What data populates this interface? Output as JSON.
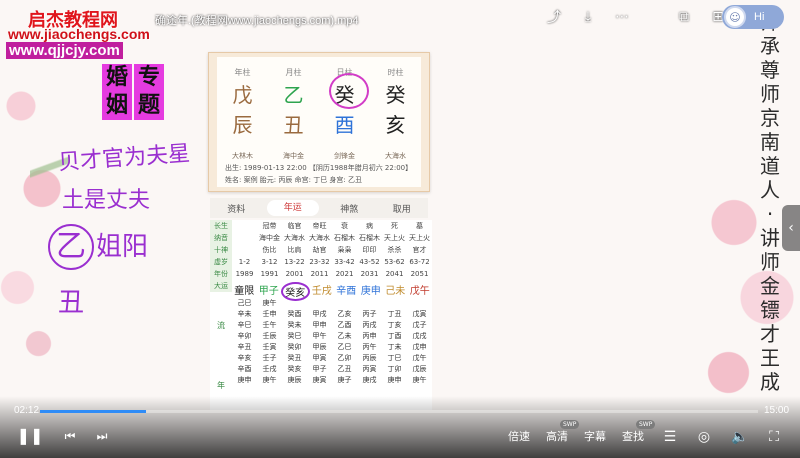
{
  "watermark": {
    "line1": "启杰教程网",
    "line2": "www.jiaochengs.com",
    "line3": "www.qjjcjy.com"
  },
  "video_title": "确途年.(教程网www.jiaochengs.com).mp4",
  "top_controls": {
    "icons": [
      "share-icon",
      "download-icon",
      "more-icon",
      "pip-icon",
      "grid-icon"
    ],
    "assistant_label": "Hi"
  },
  "slide": {
    "topic_tags": [
      "婚",
      "专",
      "姻",
      "题"
    ],
    "handwriting": [
      "贝才官为夫星",
      "土是丈夫",
      "乙",
      "姐阳",
      "丑"
    ],
    "vertical_caption": [
      "师",
      "承",
      "尊",
      "师",
      "京",
      "南",
      "道",
      "人",
      "·",
      "讲",
      "师",
      "金",
      "镖",
      "才",
      "王",
      "成"
    ],
    "bazi_card": {
      "pillar_heads": [
        "年柱",
        "月柱",
        "日柱",
        "时柱"
      ],
      "stems": [
        "戊",
        "乙",
        "癸",
        "癸"
      ],
      "branches": [
        "辰",
        "丑",
        "酉",
        "亥"
      ],
      "nayin": [
        "大林木",
        "海中金",
        "剑锋金",
        "大海水"
      ],
      "birth": "出生: 1989-01-13 22:00  【阴历1988年腊月初六 22:00】",
      "info": "姓名: 案例    胎元: 丙辰  命宫: 丁巳  身宫: 乙丑"
    },
    "tabs": [
      "资料",
      "年运",
      "神煞",
      "取用"
    ],
    "active_tab": "年运",
    "table_labels": [
      "长生",
      "纳音",
      "十神",
      "虚岁",
      "年份",
      "大运"
    ],
    "table_columns": [
      [
        "",
        "",
        "",
        "1-2",
        "1989"
      ],
      [
        "冠带",
        "海中金",
        "伤比",
        "3-12",
        "1991"
      ],
      [
        "临官",
        "大海水",
        "比肩",
        "13-22",
        "2001"
      ],
      [
        "帝旺",
        "大海水",
        "劫官",
        "23-32",
        "2011"
      ],
      [
        "衰",
        "石榴木",
        "枭枭",
        "33-42",
        "2021"
      ],
      [
        "病",
        "石榴木",
        "印印",
        "43-52",
        "2031"
      ],
      [
        "死",
        "天上火",
        "杀杀",
        "53-62",
        "2041"
      ],
      [
        "墓",
        "天上火",
        "官才",
        "63-72",
        "2051"
      ]
    ],
    "dayun": [
      "童限",
      "甲子",
      "癸亥",
      "壬戌",
      "辛酉",
      "庚申",
      "己未",
      "戊午"
    ],
    "liunian_label": "流",
    "liunian_label2": "年",
    "liunian": [
      [
        "己巳",
        "庚午",
        "",
        "",
        "",
        "",
        "",
        ""
      ],
      [
        "辛未",
        "壬申",
        "癸酉",
        "甲戌",
        "乙亥",
        "丙子",
        "丁丑",
        "戊寅"
      ],
      [
        "辛巳",
        "壬午",
        "癸未",
        "甲申",
        "乙酉",
        "丙戌",
        "丁亥",
        "戊子"
      ],
      [
        "辛卯",
        "壬辰",
        "癸巳",
        "甲午",
        "乙未",
        "丙申",
        "丁酉",
        "戊戌"
      ],
      [
        "辛丑",
        "壬寅",
        "癸卯",
        "甲辰",
        "乙巳",
        "丙午",
        "丁未",
        "戊申"
      ],
      [
        "辛亥",
        "壬子",
        "癸丑",
        "甲寅",
        "乙卯",
        "丙辰",
        "丁巳",
        "戊午"
      ],
      [
        "辛酉",
        "壬戌",
        "癸亥",
        "甲子",
        "乙丑",
        "丙寅",
        "丁卯",
        "戊辰"
      ],
      [
        "庚申",
        "庚午",
        "庚辰",
        "庚寅",
        "庚子",
        "庚戌",
        "庚申",
        "庚午"
      ]
    ]
  },
  "player": {
    "current_time": "02:12",
    "duration": "15:00",
    "progress": 0.147,
    "controls": {
      "speed": "倍速",
      "quality": "高清",
      "subtitle": "字幕",
      "search": "查找",
      "badge": "SWP"
    },
    "colors": {
      "progress": "#2f8cf7",
      "tag": "#e53be0",
      "handwriting": "#9a2fd0"
    }
  }
}
